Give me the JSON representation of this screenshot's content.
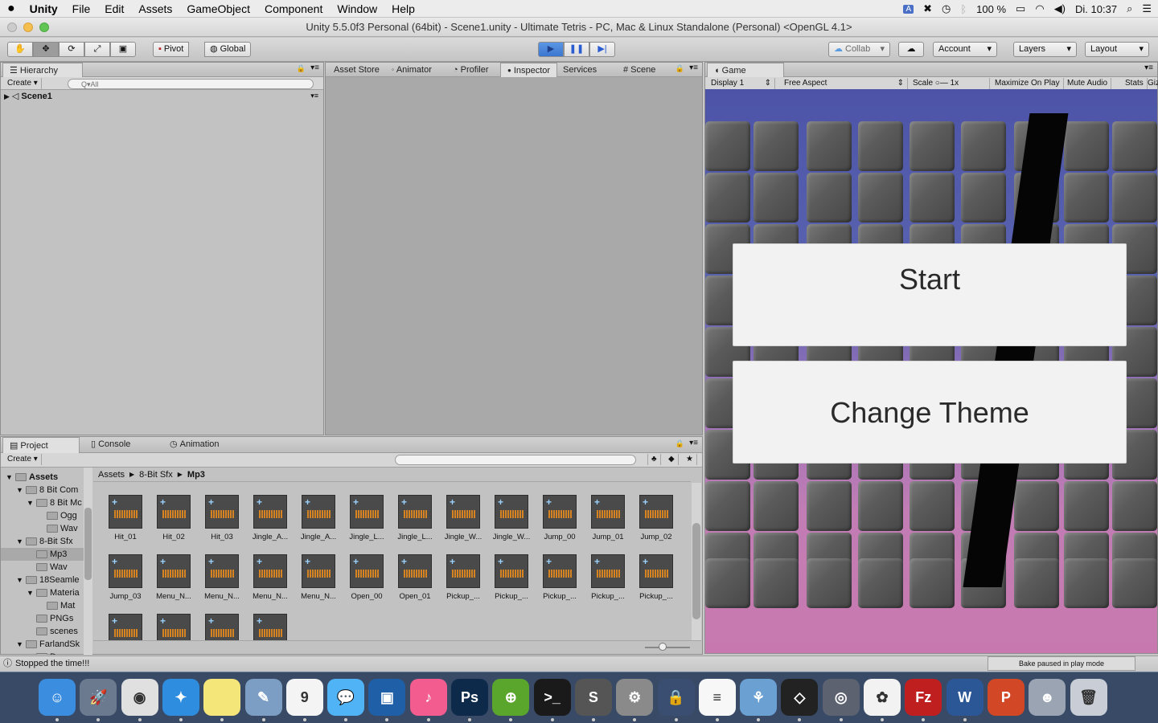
{
  "menubar": {
    "app": "Unity",
    "items": [
      "File",
      "Edit",
      "Assets",
      "GameObject",
      "Component",
      "Window",
      "Help"
    ],
    "battery": "100 %",
    "clock": "Di. 10:37"
  },
  "window": {
    "title": "Unity 5.5.0f3 Personal (64bit) - Scene1.unity - Ultimate Tetris - PC, Mac & Linux Standalone (Personal) <OpenGL 4.1>"
  },
  "toolbar": {
    "pivot": "Pivot",
    "global": "Global",
    "collab": "Collab",
    "account": "Account",
    "layers": "Layers",
    "layout": "Layout"
  },
  "hierarchy": {
    "tab": "Hierarchy",
    "create": "Create",
    "search_placeholder": "Q▾All",
    "scene": "Scene1"
  },
  "center_tabs": [
    "Asset Store",
    "Animator",
    "Profiler",
    "Inspector",
    "Services",
    "Scene"
  ],
  "game": {
    "tab": "Game",
    "display": "Display 1",
    "aspect": "Free Aspect",
    "scale_label": "Scale",
    "scale_value": "1x",
    "opts": [
      "Maximize On Play",
      "Mute Audio",
      "Stats",
      "Gizmos"
    ],
    "start_label": "Start",
    "theme_label": "Change Theme",
    "bake_status": "Bake paused in play mode"
  },
  "project": {
    "tabs": [
      "Project",
      "Console",
      "Animation"
    ],
    "create": "Create",
    "tree": [
      {
        "label": "Assets",
        "depth": 0,
        "bold": true
      },
      {
        "label": "8 Bit Com",
        "depth": 1
      },
      {
        "label": "8 Bit Mc",
        "depth": 2
      },
      {
        "label": "Ogg",
        "depth": 3
      },
      {
        "label": "Wav",
        "depth": 3
      },
      {
        "label": "8-Bit Sfx",
        "depth": 1
      },
      {
        "label": "Mp3",
        "depth": 2,
        "selected": true
      },
      {
        "label": "Wav",
        "depth": 2
      },
      {
        "label": "18Seamle",
        "depth": 1
      },
      {
        "label": "Materia",
        "depth": 2
      },
      {
        "label": "Mat",
        "depth": 3
      },
      {
        "label": "PNGs",
        "depth": 2
      },
      {
        "label": "scenes",
        "depth": 2
      },
      {
        "label": "FarlandSk",
        "depth": 1
      },
      {
        "label": "Demo",
        "depth": 2
      }
    ],
    "breadcrumb": [
      "Assets",
      "8-Bit Sfx",
      "Mp3"
    ],
    "assets": [
      "Hit_01",
      "Hit_02",
      "Hit_03",
      "Jingle_A...",
      "Jingle_A...",
      "Jingle_L...",
      "Jingle_L...",
      "Jingle_W...",
      "Jingle_W...",
      "Jump_00",
      "Jump_01",
      "Jump_02",
      "Jump_03",
      "Menu_N...",
      "Menu_N...",
      "Menu_N...",
      "Menu_N...",
      "Open_00",
      "Open_01",
      "Pickup_...",
      "Pickup_...",
      "Pickup_...",
      "Pickup_...",
      "Pickup_...",
      "",
      "",
      "",
      ""
    ]
  },
  "status": {
    "message": "Stopped the time!!!"
  },
  "dock": [
    {
      "name": "finder-icon",
      "c": "#3b8de0",
      "t": "☺"
    },
    {
      "name": "launchpad-icon",
      "c": "#6b7a8f",
      "t": "🚀"
    },
    {
      "name": "chrome-icon",
      "c": "#e0e0e0",
      "t": "◉"
    },
    {
      "name": "safari-icon",
      "c": "#2f8de0",
      "t": "✦"
    },
    {
      "name": "notes-icon",
      "c": "#f5e67a",
      "t": ""
    },
    {
      "name": "preview-icon",
      "c": "#7c9ec4",
      "t": "✎"
    },
    {
      "name": "calendar-icon",
      "c": "#f4f4f4",
      "t": "9"
    },
    {
      "name": "messages-icon",
      "c": "#4fb3f5",
      "t": "💬"
    },
    {
      "name": "virtualbox-icon",
      "c": "#1f5fa8",
      "t": "▣"
    },
    {
      "name": "itunes-icon",
      "c": "#f25c8f",
      "t": "♪"
    },
    {
      "name": "photoshop-icon",
      "c": "#0d2a4a",
      "t": "Ps"
    },
    {
      "name": "gps-icon",
      "c": "#5aa52c",
      "t": "⊕"
    },
    {
      "name": "terminal-icon",
      "c": "#1a1a1a",
      "t": ">_"
    },
    {
      "name": "sublime-icon",
      "c": "#555",
      "t": "S"
    },
    {
      "name": "system-preferences-icon",
      "c": "#8a8a8a",
      "t": "⚙"
    },
    {
      "name": "keychain-icon",
      "c": "#3a4e72",
      "t": "🔒"
    },
    {
      "name": "reminders-icon",
      "c": "#f7f7f7",
      "t": "≡"
    },
    {
      "name": "migration-icon",
      "c": "#6aa0d2",
      "t": "⚘"
    },
    {
      "name": "unity-icon",
      "c": "#222",
      "t": "◇"
    },
    {
      "name": "blender-icon",
      "c": "#5c6270",
      "t": "◎"
    },
    {
      "name": "photos-icon",
      "c": "#f2f2f2",
      "t": "✿"
    },
    {
      "name": "filezilla-icon",
      "c": "#bf1f1f",
      "t": "Fz"
    },
    {
      "name": "word-icon",
      "c": "#2b5797",
      "t": "W"
    },
    {
      "name": "powerpoint-icon",
      "c": "#d24726",
      "t": "P"
    },
    {
      "name": "user-icon",
      "c": "#9aa4b2",
      "t": "☻"
    },
    {
      "name": "trash-icon",
      "c": "#c9ced6",
      "t": "🗑"
    }
  ]
}
